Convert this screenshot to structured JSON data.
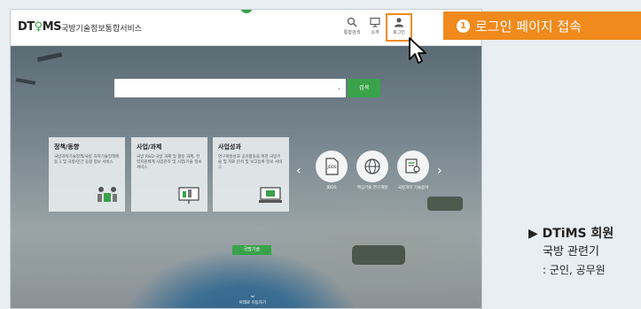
{
  "header": {
    "logo_text": "DT",
    "logo_text2": "MS",
    "site_name": "국방기술정보통합서비스",
    "buttons": [
      {
        "label": "통합검색",
        "icon": "search-icon"
      },
      {
        "label": "소개",
        "icon": "monitor-icon"
      },
      {
        "label": "로그인",
        "icon": "user-icon"
      }
    ]
  },
  "search": {
    "placeholder": "",
    "button_label": "검색"
  },
  "cards": [
    {
      "title": "정책/동향",
      "desc": "국방과학기술정책/국방 과학기술정책에 동 1 및 국방/민간 동향 정보 서비스",
      "icon": "people-chart-icon"
    },
    {
      "title": "사업/과제",
      "desc": "국방 R&D 국방 과제 및 활용 과제, 전력지원체계 사업관리 및 시험/기술 정보 서비스",
      "icon": "presentation-icon"
    },
    {
      "title": "사업성과",
      "desc": "연구개발성과 공유활동을 위한 국방기술 및 자료 분석 및 보고등록 정보 서비스",
      "icon": "monitor-report-icon"
    }
  ],
  "carousel": [
    {
      "label": "JDDS",
      "icon": "document-icon"
    },
    {
      "label": "핵심기술 연구개발",
      "icon": "globe-icon"
    },
    {
      "label": "국방과학 기술용어",
      "icon": "book-search-icon"
    }
  ],
  "pill_label": "국방기술",
  "scroll_hint": "아래로 이동하기",
  "callout": {
    "number": "1",
    "text": "로그인 페이지 접속"
  },
  "notes": {
    "line1": "▶ DTiMS 회원",
    "line2": "국방 관련기",
    "line3": ": 군인, 공무원"
  },
  "colors": {
    "accent_green": "#3aa24a",
    "callout_orange": "#f08a1c"
  }
}
